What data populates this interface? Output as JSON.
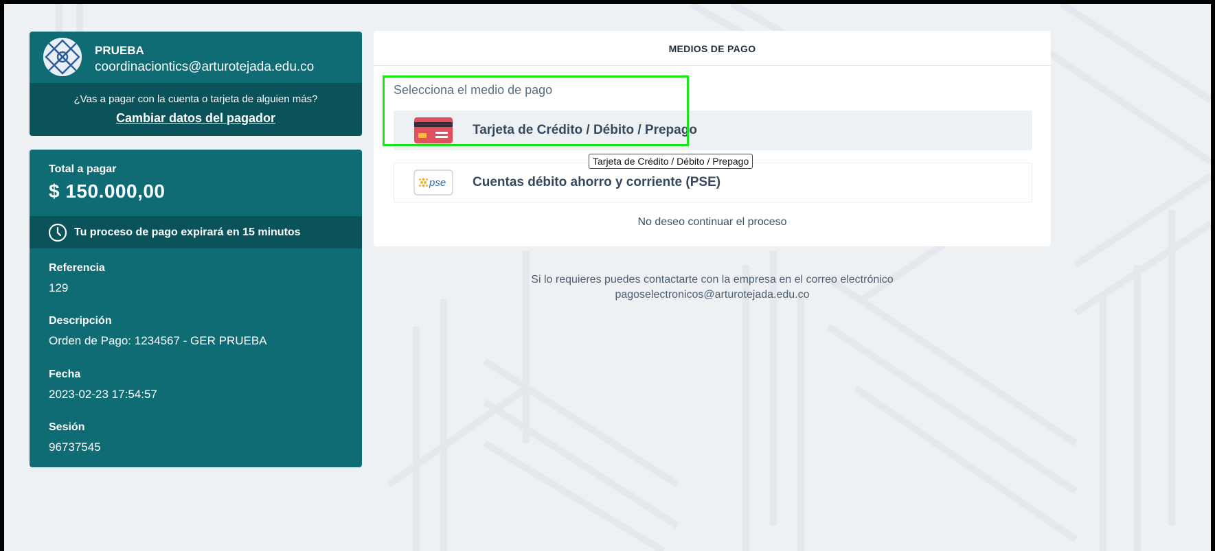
{
  "payer": {
    "name": "PRUEBA",
    "email": "coordinaciontics@arturotejada.edu.co",
    "question": "¿Vas a pagar con la cuenta o tarjeta de alguien más?",
    "change_link": "Cambiar datos del pagador"
  },
  "summary": {
    "total_label": "Total a pagar",
    "total_amount": "$ 150.000,00",
    "expire_text": "Tu proceso de pago expirará en 15 minutos",
    "fields": [
      {
        "label": "Referencia",
        "value": "129"
      },
      {
        "label": "Descripción",
        "value": "Orden de Pago: 1234567 - GER PRUEBA"
      },
      {
        "label": "Fecha",
        "value": "2023-02-23 17:54:57"
      },
      {
        "label": "Sesión",
        "value": "96737545"
      }
    ]
  },
  "methods": {
    "title": "MEDIOS DE PAGO",
    "prompt": "Selecciona el medio de pago",
    "options": [
      {
        "label": "Tarjeta de Crédito / Débito / Prepago",
        "icon": "credit-card-icon"
      },
      {
        "label": "Cuentas débito ahorro y corriente (PSE)",
        "icon": "pse-logo-icon",
        "logo_text": "pse"
      }
    ],
    "tooltip": "Tarjeta de Crédito / Débito / Prepago",
    "cancel": "No deseo continuar el proceso"
  },
  "contact": {
    "line1": "Si lo requieres puedes contactarte con la empresa en el correo electrónico",
    "line2": "pagoselectronicos@arturotejada.edu.co"
  },
  "colors": {
    "teal": "#0f6c75",
    "teal_dark": "#0b535b",
    "highlight": "#19e619",
    "card_red": "#e0505f"
  }
}
